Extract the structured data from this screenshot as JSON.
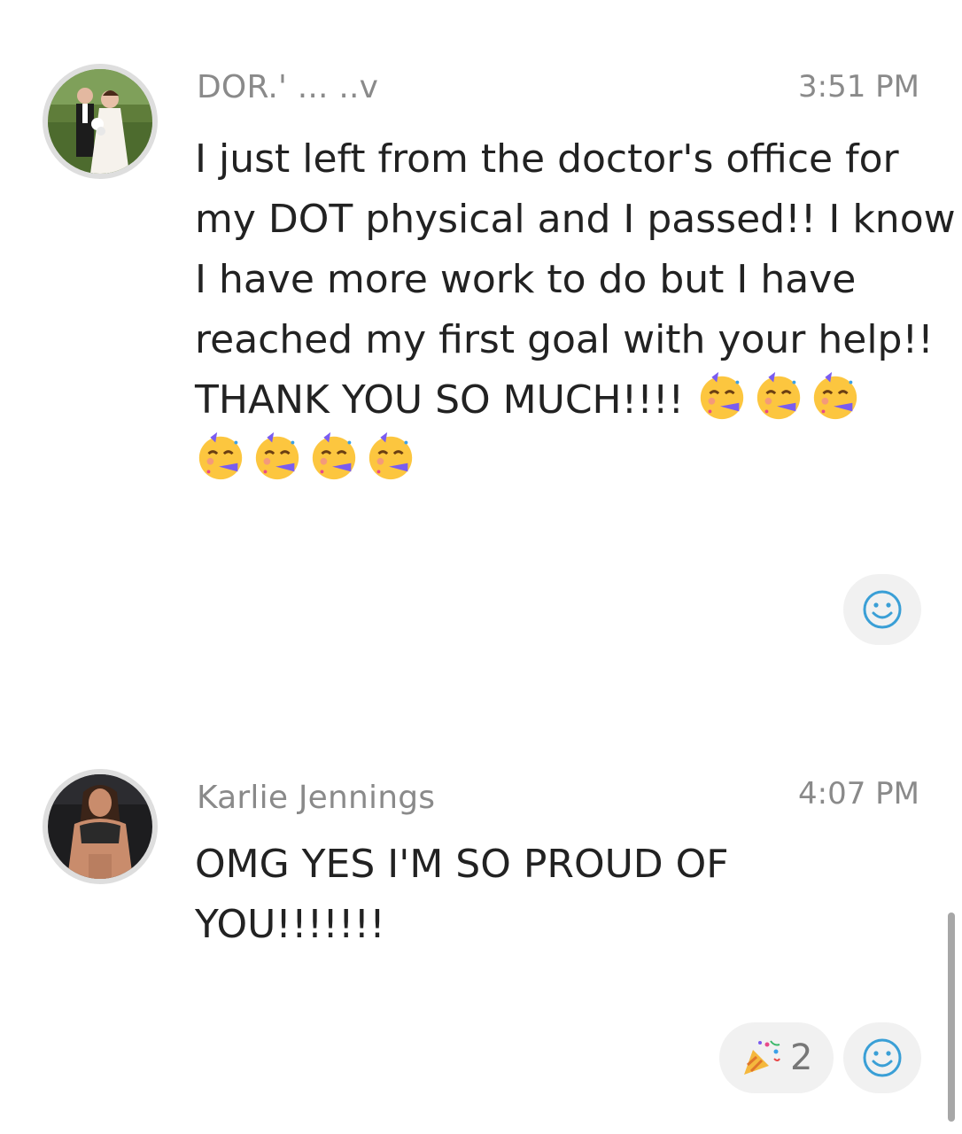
{
  "messages": [
    {
      "author": "DOR.' ... ..v",
      "time": "3:51 PM",
      "lines": [
        "I just left from the doctor's office for",
        "my DOT physical and I passed!! I know",
        "I have more work to do but I have",
        "reached my first goal with your help!!",
        "THANK YOU SO MUCH!!!!"
      ],
      "emoji": "partying-face",
      "emoji_count": 7,
      "add_reaction_icon": "smiley-face-icon"
    },
    {
      "author": "Karlie Jennings",
      "time": "4:07 PM",
      "lines": [
        "OMG YES I'M SO PROUD OF",
        "YOU!!!!!!!"
      ],
      "reactions": [
        {
          "icon": "party-popper-icon",
          "count": "2"
        }
      ],
      "add_reaction_icon": "smiley-face-icon"
    }
  ],
  "colors": {
    "author_text": "#8a8a8a",
    "body_text": "#222222",
    "reaction_bg": "#f1f1f1",
    "reaction_icon": "#3a9fd6"
  }
}
